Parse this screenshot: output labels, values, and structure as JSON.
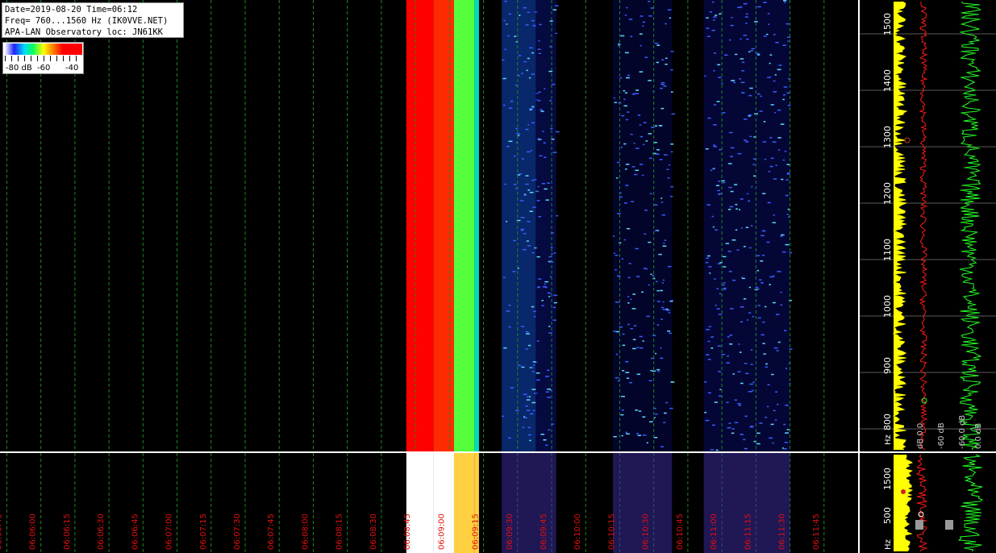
{
  "header": {
    "line1": "Date=2019-08-20 Time=06:12",
    "line2": "Freq= 760...1560 Hz (IK0VVE.NET)",
    "line3": "APA-LAN Observatory loc: JN61KK"
  },
  "color_scale": {
    "labels": [
      "-80 dB",
      "-60",
      "-40"
    ]
  },
  "colors": {
    "background": "#000000",
    "grid": "#1d8a1d",
    "time_label": "#e01010",
    "freq_label": "#ffffff",
    "trace_a": "#ffff00",
    "trace_b": "#ff1a1a",
    "trace_c": "#22ff22"
  },
  "chart_data": {
    "type": "heatmap",
    "title": "",
    "xlabel": "",
    "ylabel": "Hz",
    "x_ticks": [
      "06:05:45",
      "06:06:00",
      "06:06:15",
      "06:06:30",
      "06:06:45",
      "06:07:00",
      "06:07:15",
      "06:07:30",
      "06:07:45",
      "06:08:00",
      "06:08:15",
      "06:08:30",
      "06:08:45",
      "06:09:00",
      "06:09:15",
      "06:09:30",
      "06:09:45",
      "06:10:00",
      "06:10:15",
      "06:10:30",
      "06:10:45",
      "06:11:00",
      "06:11:15",
      "06:11:30",
      "06:11:45"
    ],
    "xlim": [
      "06:05:42",
      "06:12:00"
    ],
    "y_ticks": [
      800,
      900,
      1000,
      1100,
      1200,
      1300,
      1400,
      1500
    ],
    "ylim": [
      760,
      1560
    ],
    "y_unit": "Hz",
    "lower_panel_ticks": [
      500,
      1500
    ],
    "lower_panel_unit": "Hz",
    "trace_labels": [
      "dB 0.0",
      "-60 dB",
      "-60.0 dB",
      "0.0 dB"
    ],
    "intensity_range_db": [
      -80,
      -40
    ],
    "intensity_bands": [
      {
        "start": "06:08:41",
        "end": "06:08:53",
        "level_db": -40
      },
      {
        "start": "06:08:53",
        "end": "06:09:02",
        "level_db": -42
      },
      {
        "start": "06:09:02",
        "end": "06:09:11",
        "level_db": -56
      },
      {
        "start": "06:09:11",
        "end": "06:09:13",
        "level_db": -63
      },
      {
        "start": "06:09:23",
        "end": "06:09:38",
        "level_db": -72
      },
      {
        "start": "06:09:38",
        "end": "06:09:47",
        "level_db": -77
      },
      {
        "start": "06:10:12",
        "end": "06:10:38",
        "level_db": -79
      },
      {
        "start": "06:10:52",
        "end": "06:11:30",
        "level_db": -78
      }
    ]
  }
}
